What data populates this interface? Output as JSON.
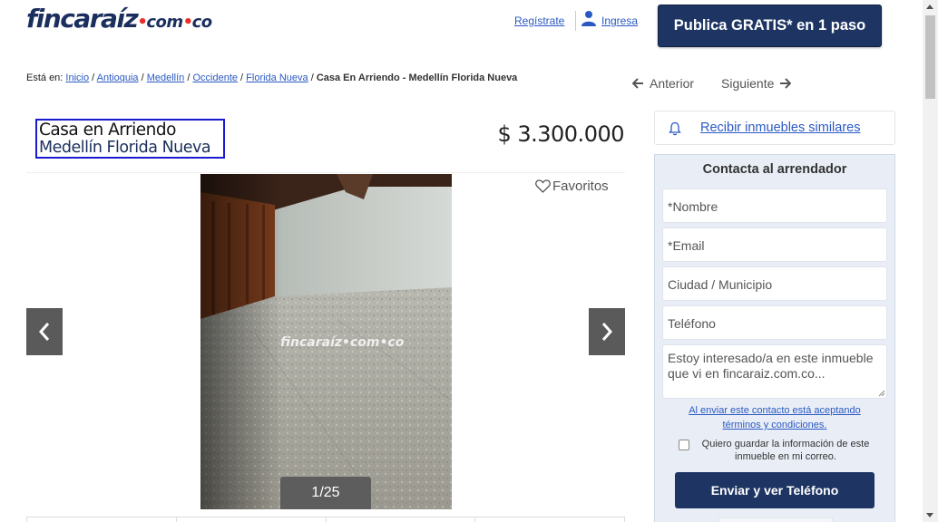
{
  "header": {
    "logo": {
      "brand": "fincaraíz",
      "dot": "•",
      "com": "com",
      "dot2": "•",
      "co": "co"
    },
    "register_label": "Regístrate",
    "login_label": "Ingresa",
    "publish_label": "Publica GRATIS* en 1 paso"
  },
  "breadcrumb": {
    "prefix": "Está en:",
    "items": [
      "Inicio",
      "Antioquia",
      "Medellín",
      "Occidente",
      "Florida Nueva"
    ],
    "current": "Casa En Arriendo - Medellín Florida Nueva"
  },
  "nav": {
    "prev_label": "Anterior",
    "next_label": "Siguiente"
  },
  "listing": {
    "title": "Casa en Arriendo",
    "subtitle": "Medellín Florida Nueva",
    "price": "$ 3.300.000",
    "favorites_label": "Favoritos",
    "photo_counter": "1/25",
    "watermark": "fincaraíz•com•co"
  },
  "alert": {
    "label": "Recibir inmuebles similares"
  },
  "contact_form": {
    "title": "Contacta al arrendador",
    "name_placeholder": "*Nombre",
    "email_placeholder": "*Email",
    "city_placeholder": "Ciudad / Municipio",
    "phone_placeholder": "Teléfono",
    "message_text": "Estoy interesado/a en este inmueble que vi en fincaraiz.com.co...",
    "terms_line1": "Al enviar este contacto está aceptando",
    "terms_line2": "términos y condiciones.",
    "save_info_label": "Quiero guardar la información de este inmueble en mi correo.",
    "submit_label": "Enviar y ver Teléfono"
  },
  "colors": {
    "brand_navy": "#1e3563",
    "link_blue": "#2b59c3",
    "logo_red": "#e8312a"
  }
}
